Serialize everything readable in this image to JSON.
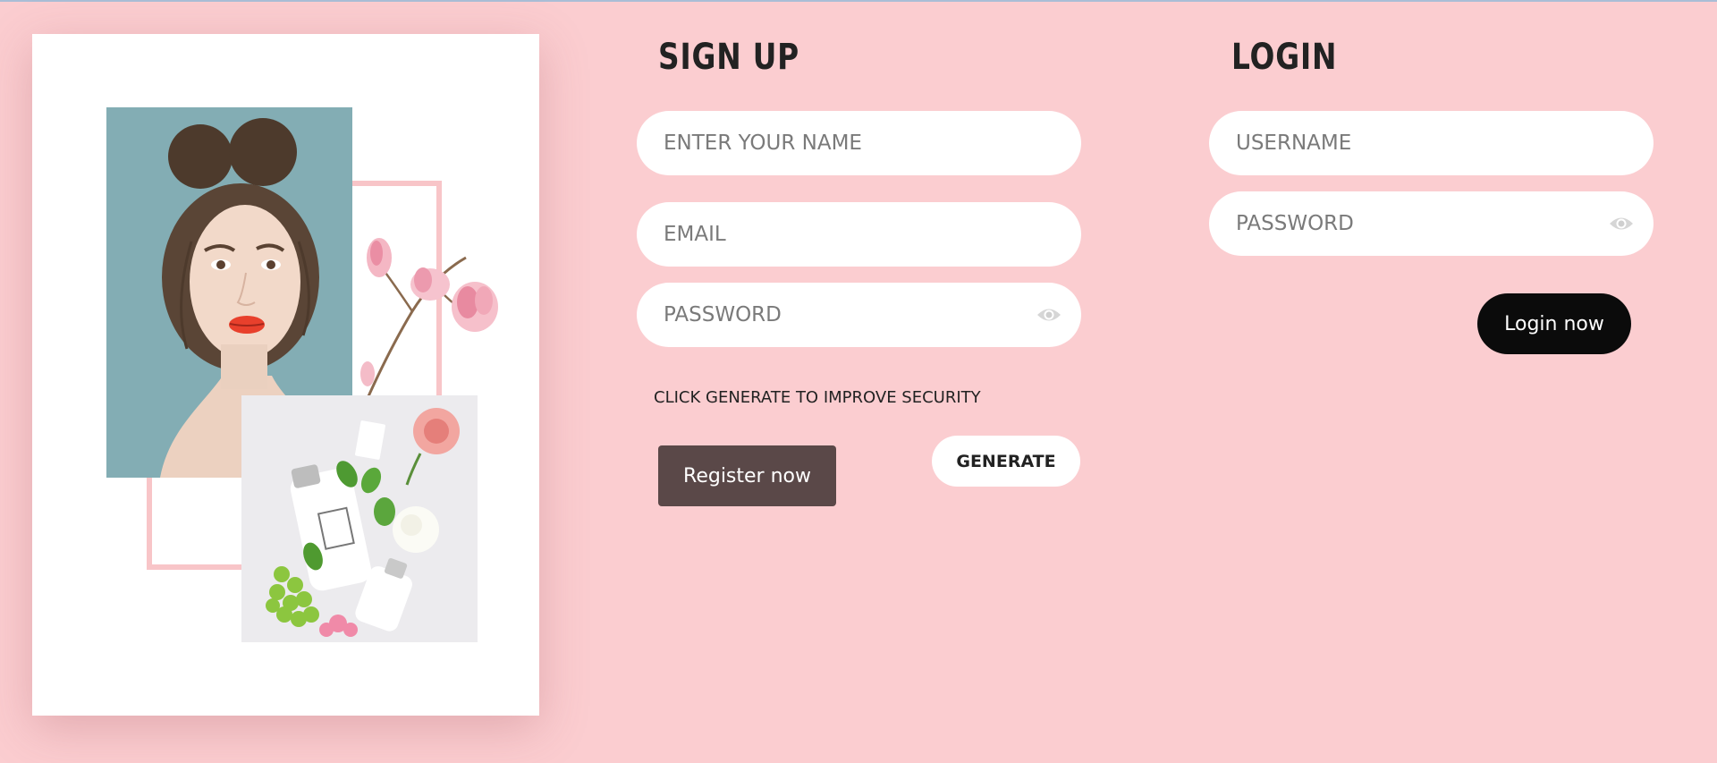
{
  "signup": {
    "title": "SIGN UP",
    "name_placeholder": "ENTER YOUR NAME",
    "email_placeholder": "EMAIL",
    "password_placeholder": "PASSWORD",
    "hint": "CLICK GENERATE TO IMPROVE SECURITY",
    "register_label": "Register now",
    "generate_label": "GENERATE"
  },
  "login": {
    "title": "LOGIN",
    "username_placeholder": "USERNAME",
    "password_placeholder": "PASSWORD",
    "login_label": "Login now"
  },
  "icons": {
    "password_toggle": "eye-icon"
  },
  "colors": {
    "background": "#fbcdd0",
    "card": "#ffffff",
    "register_button": "#5a4848",
    "login_button": "#0b0b0b",
    "input": "#ffffff"
  }
}
